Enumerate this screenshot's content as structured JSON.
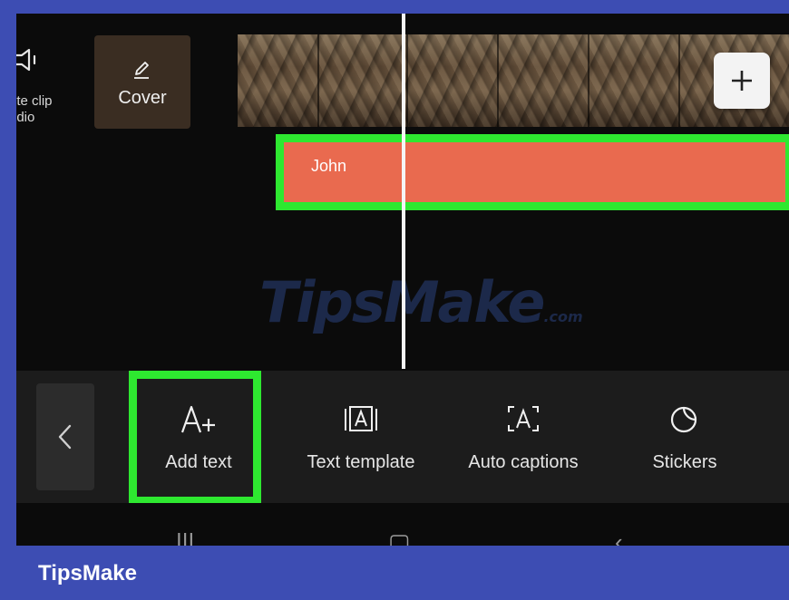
{
  "colors": {
    "frame": "#3d4db3",
    "highlight": "#2ee830",
    "text_track": "#e96a4f",
    "toolbar_bg": "#1c1c1c"
  },
  "top_bar": {
    "mute_label": "ute clip\nudio",
    "mute_icon": "speaker-icon",
    "cover_label": "Cover",
    "cover_icon": "pencil-icon",
    "add_clip_icon": "plus-icon"
  },
  "text_track": {
    "label": "John"
  },
  "watermark": {
    "text": "TipsMake",
    "suffix": ".com"
  },
  "toolbar": {
    "back_icon": "chevron-left-icon",
    "tools": [
      {
        "label": "Add text",
        "icon": "add-text-icon"
      },
      {
        "label": "Text template",
        "icon": "text-template-icon"
      },
      {
        "label": "Auto captions",
        "icon": "auto-captions-icon"
      },
      {
        "label": "Stickers",
        "icon": "sticker-icon"
      }
    ]
  },
  "caption": {
    "brand": "TipsMake"
  }
}
